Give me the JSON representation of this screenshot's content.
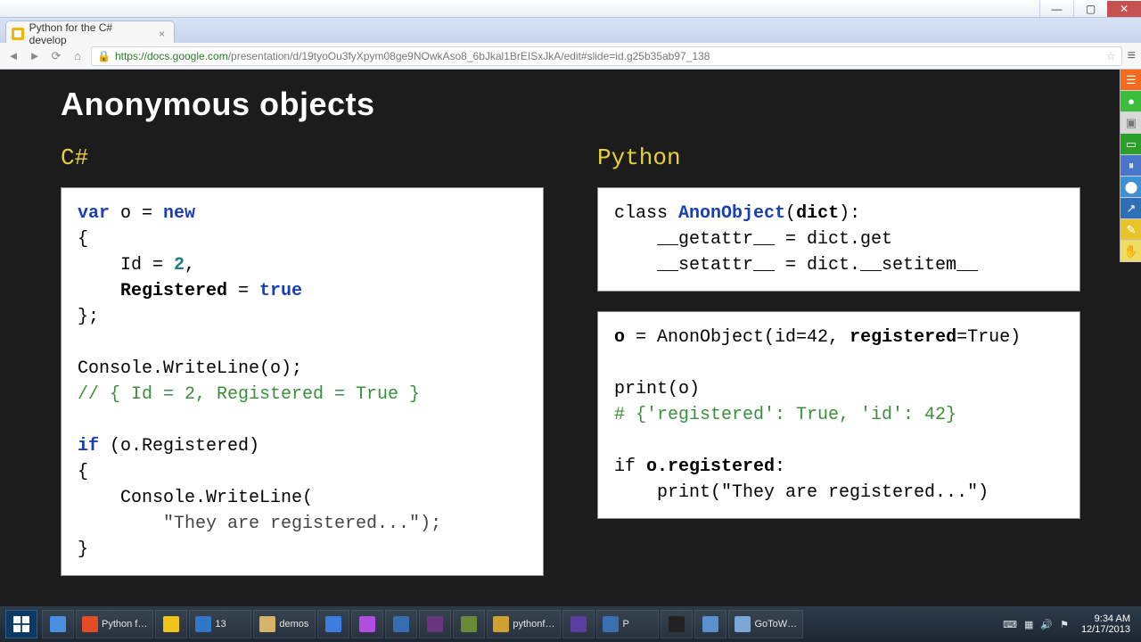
{
  "window": {
    "min": "—",
    "max": "▢",
    "close": "✕"
  },
  "browser": {
    "tab_title": "Python for the C# develop",
    "tab_close": "×",
    "url_host": "https://docs.google.com",
    "url_path": "/presentation/d/19tyoOu3fyXpym08ge9NOwkAso8_6bJkal1BrEISxJkA/edit#slide=id.g25b35ab97_138"
  },
  "slide": {
    "title": "Anonymous objects",
    "left_label": "C#",
    "right_label": "Python"
  },
  "csharp": {
    "l1a": "var",
    "l1b": " o = ",
    "l1c": "new",
    "l2": "{",
    "l3a": "    Id = ",
    "l3b": "2",
    "l3c": ",",
    "l4a": "    Registered",
    "l4b": " = ",
    "l4c": "true",
    "l5": "};",
    "l6": "",
    "l7": "Console.WriteLine(o);",
    "l8": "// { Id = 2, Registered = True }",
    "l9": "",
    "l10a": "if",
    "l10b": " (o.Registered)",
    "l11": "{",
    "l12": "    Console.WriteLine(",
    "l13": "        \"They are registered...\");",
    "l14": "}"
  },
  "py1": {
    "l1a": "class ",
    "l1b": "AnonObject",
    "l1c": "(",
    "l1d": "dict",
    "l1e": "):",
    "l2": "    __getattr__ = dict.get",
    "l3": "    __setattr__ = dict.__setitem__"
  },
  "py2": {
    "l1a": "o",
    "l1b": " = AnonObject(id=42, ",
    "l1c": "registered",
    "l1d": "=True)",
    "l2": "",
    "l3": "print(o)",
    "l4": "# {'registered': True, 'id': 42}",
    "l5": "",
    "l6a": "if ",
    "l6b": "o.registered",
    "l6c": ":",
    "l7": "    print(\"They are registered...\")"
  },
  "taskbar": {
    "items": [
      {
        "label": "",
        "color": "#4a8fe0"
      },
      {
        "label": "Python f…",
        "color": "#e34c26"
      },
      {
        "label": "",
        "color": "#f0c419"
      },
      {
        "label": "13",
        "color": "#2f77c6"
      },
      {
        "label": "demos",
        "color": "#d7b36a"
      },
      {
        "label": "",
        "color": "#3c7de0"
      },
      {
        "label": "",
        "color": "#b14de0"
      },
      {
        "label": "",
        "color": "#356db0"
      },
      {
        "label": "",
        "color": "#68357f"
      },
      {
        "label": "",
        "color": "#6a8a3a"
      },
      {
        "label": "pythonf…",
        "color": "#d0a030"
      },
      {
        "label": "",
        "color": "#5a3fa0"
      },
      {
        "label": "P",
        "color": "#3c6fb0"
      },
      {
        "label": "",
        "color": "#222"
      },
      {
        "label": "",
        "color": "#5a8fd0"
      },
      {
        "label": "GoToW…",
        "color": "#7aa7d8"
      }
    ],
    "tray": {
      "kb": "⌨",
      "net": "▦",
      "vol": "🔊",
      "flag": "⚑"
    },
    "time": "9:34 AM",
    "date": "12/17/2013"
  },
  "floatbar": [
    "☰",
    "●",
    "▣",
    "▭",
    "⏸",
    "⬤",
    "↗",
    "✎",
    "✋"
  ]
}
